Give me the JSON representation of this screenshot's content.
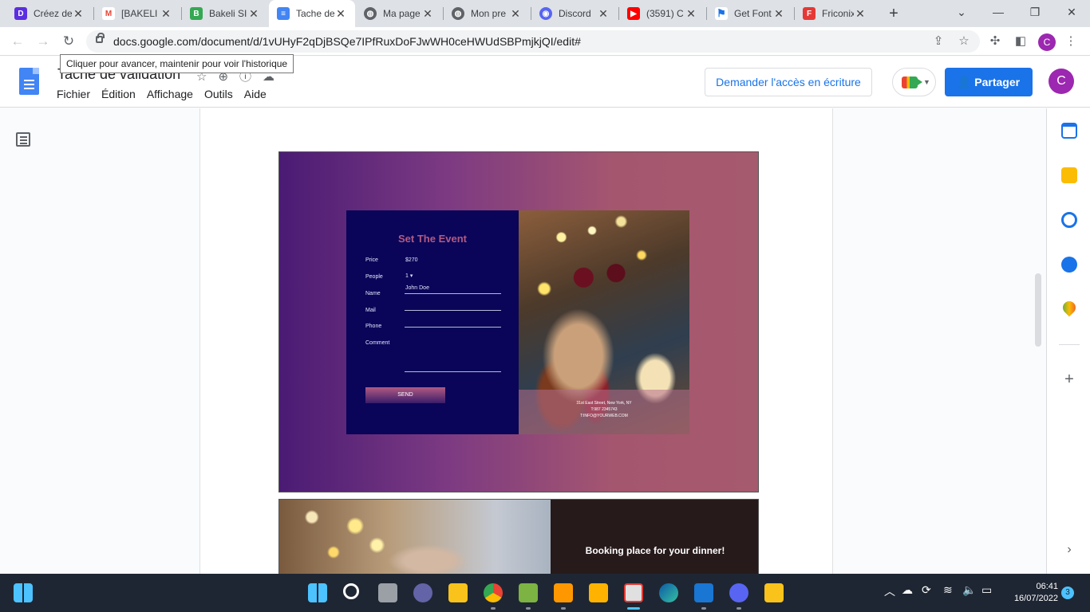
{
  "browser": {
    "tabs": [
      {
        "title": "Créez de",
        "icon": "dots-app-icon",
        "color": "#5b2ee0"
      },
      {
        "title": "[BAKELI",
        "icon": "gmail-icon",
        "color": "#ea4335"
      },
      {
        "title": "Bakeli SI",
        "icon": "bakeli-icon",
        "color": "#34a853"
      },
      {
        "title": "Tache de",
        "icon": "google-docs-icon",
        "color": "#4285f4"
      },
      {
        "title": "Ma page",
        "icon": "globe-icon",
        "color": "#5f6368"
      },
      {
        "title": "Mon pre",
        "icon": "globe-icon",
        "color": "#5f6368"
      },
      {
        "title": "Discord",
        "icon": "discord-icon",
        "color": "#5865f2"
      },
      {
        "title": "(3591) C",
        "icon": "youtube-icon",
        "color": "#ff0000"
      },
      {
        "title": "Get Font",
        "icon": "flag-icon",
        "color": "#1a73e8"
      },
      {
        "title": "Friconix",
        "icon": "friconix-icon",
        "color": "#e53935"
      }
    ],
    "url": "docs.google.com/document/d/1vUHyF2qDjBSQe7IPfRuxDoFJwWH0ceHWUdSBPmjkjQI/edit#",
    "tooltip": "Cliquer pour avancer, maintenir pour voir l'historique",
    "profile_initial": "C"
  },
  "docs": {
    "title": "Tache de validation",
    "menu": [
      "Fichier",
      "Édition",
      "Affichage",
      "Outils",
      "Aide"
    ],
    "access_button": "Demander l'accès en écriture",
    "share_button": "Partager",
    "avatar_initial": "C"
  },
  "image1": {
    "form_title": "Set The Event",
    "price_label": "Price",
    "price_value": "$270",
    "people_label": "People",
    "people_value": "1 ▾",
    "name_label": "Name",
    "name_value": "John Doe",
    "mail_label": "Mail",
    "phone_label": "Phone",
    "comment_label": "Comment",
    "send_label": "SEND",
    "address_1": "31st East Street, New York, NY",
    "address_2": "T:987 2345743",
    "address_3": "T:INFO@YOURWEB.COM"
  },
  "image2": {
    "heading": "Booking place for your dinner!"
  },
  "taskbar": {
    "time": "06:41",
    "date": "16/07/2022",
    "notifications": "3"
  }
}
